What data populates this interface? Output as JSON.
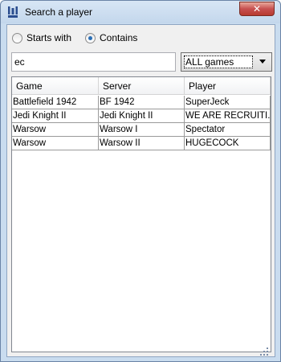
{
  "window": {
    "title": "Search a player",
    "app_icon": "ut-logo-icon",
    "close_label": "✕"
  },
  "search_mode": {
    "options": [
      {
        "label": "Starts with",
        "checked": false
      },
      {
        "label": "Contains",
        "checked": true
      }
    ]
  },
  "search": {
    "value": "ec"
  },
  "game_filter": {
    "selected": "ALL games"
  },
  "table": {
    "headers": [
      "Game",
      "Server",
      "Player"
    ],
    "rows": [
      [
        "Battlefield 1942",
        "BF 1942",
        "SuperJeck"
      ],
      [
        "Jedi Knight II",
        "Jedi Knight II",
        "WE ARE RECRUITI..."
      ],
      [
        "Warsow",
        "Warsow I",
        "Spectator"
      ],
      [
        "Warsow",
        "Warsow II",
        "HUGECOCK"
      ]
    ]
  },
  "colors": {
    "accent": "#2b6fb6",
    "frame": "#c9dcef",
    "close_button": "#c75050"
  }
}
